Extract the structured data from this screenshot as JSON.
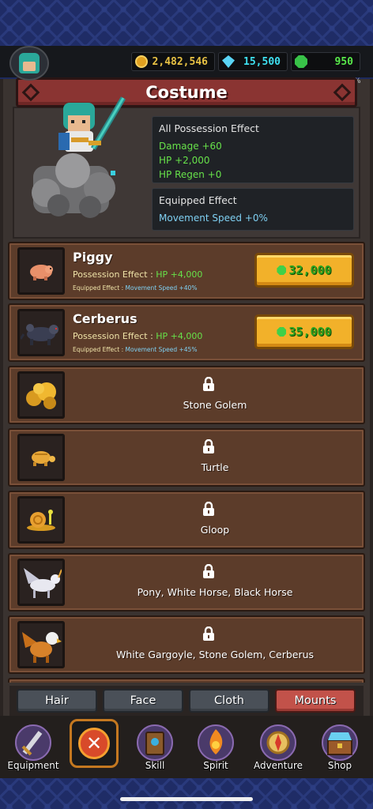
{
  "currency": {
    "gold": "2,482,546",
    "gems": "15,500",
    "emeralds": "950"
  },
  "title": "Costume",
  "percent_mark": "%",
  "all_possession": {
    "header": "All Possession Effect",
    "lines": [
      "Damage +60",
      "HP +2,000",
      "HP Regen +0"
    ]
  },
  "equipped": {
    "header": "Equipped Effect",
    "line": "Movement Speed +0%"
  },
  "items": [
    {
      "name": "Piggy",
      "poss_label": "Possession Effect : ",
      "poss_value": "HP +4,000",
      "eq_label": "Equipped Effect : ",
      "eq_value": "Movement Speed +40%",
      "price": "32,000"
    },
    {
      "name": "Cerberus",
      "poss_label": "Possession Effect : ",
      "poss_value": "HP +4,000",
      "eq_label": "Equipped Effect : ",
      "eq_value": "Movement Speed +45%",
      "price": "35,000"
    }
  ],
  "locked_items": [
    "Stone Golem",
    "Turtle",
    "Gloop",
    "Pony, White Horse, Black Horse",
    "White Gargoyle, Stone Golem, Cerberus"
  ],
  "tabs": [
    "Hair",
    "Face",
    "Cloth",
    "Mounts"
  ],
  "active_tab": "Mounts",
  "nav": [
    "Equipment",
    "Skill",
    "Spirit",
    "Adventure",
    "Shop"
  ],
  "close_glyph": "✕",
  "colors": {
    "accent_red": "#8a3432",
    "gold_text": "#e8c244",
    "gem_text": "#3ee0f0",
    "emerald_text": "#58e84a",
    "stat_green": "#67e24a",
    "stat_blue": "#7fd0f2",
    "buy_button": "#f2b12a"
  },
  "icons": {
    "gold": "coin-icon",
    "gems": "diamond-icon",
    "emeralds": "emerald-icon",
    "lock": "lock-icon"
  }
}
